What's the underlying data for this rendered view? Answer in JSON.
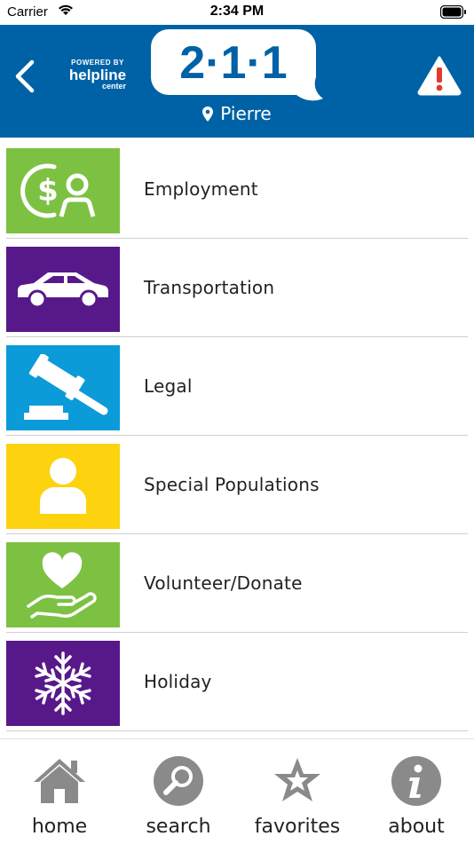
{
  "status_bar": {
    "carrier": "Carrier",
    "time": "2:34 PM"
  },
  "header": {
    "powered_by": "POWERED BY",
    "powered_brand": "helpline",
    "powered_brand_sub": "center",
    "logo": "2·1·1",
    "location": "Pierre"
  },
  "categories": [
    {
      "label": "Employment",
      "color": "#7dc143",
      "icon": "employment-icon"
    },
    {
      "label": "Transportation",
      "color": "#57198a",
      "icon": "car-icon"
    },
    {
      "label": "Legal",
      "color": "#0b9bd8",
      "icon": "gavel-icon"
    },
    {
      "label": "Special Populations",
      "color": "#fdd30f",
      "icon": "person-icon"
    },
    {
      "label": "Volunteer/Donate",
      "color": "#7dc143",
      "icon": "heart-hand-icon"
    },
    {
      "label": "Holiday",
      "color": "#57198a",
      "icon": "snowflake-icon"
    }
  ],
  "tabs": [
    {
      "label": "home",
      "icon": "home-icon"
    },
    {
      "label": "search",
      "icon": "search-icon"
    },
    {
      "label": "favorites",
      "icon": "star-icon"
    },
    {
      "label": "about",
      "icon": "info-icon"
    }
  ],
  "colors": {
    "header_blue": "#0062a6",
    "alert_red": "#e03a2f",
    "tab_gray": "#8a8a8a"
  }
}
